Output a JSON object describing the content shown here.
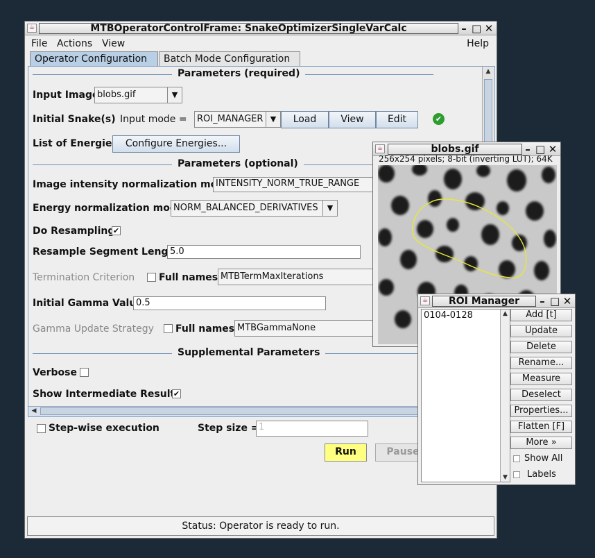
{
  "main_window": {
    "title": "MTBOperatorControlFrame: SnakeOptimizerSingleVarCalc",
    "menu": [
      "File",
      "Actions",
      "View"
    ],
    "help": "Help",
    "tabs": [
      "Operator Configuration",
      "Batch Mode Configuration"
    ],
    "sections": {
      "required": "Parameters (required)",
      "optional": "Parameters (optional)",
      "supplemental": "Supplemental Parameters"
    },
    "input_image": {
      "label": "Input Image",
      "value": "blobs.gif"
    },
    "initial_snakes": {
      "label": "Initial Snake(s)",
      "mode_label": "Input mode =",
      "mode_value": "ROI_MANAGER",
      "load": "Load",
      "view": "View",
      "edit": "Edit"
    },
    "energies": {
      "label": "List of Energies",
      "button": "Configure Energies..."
    },
    "intensity_norm": {
      "label": "Image intensity normalization mode",
      "value": "INTENSITY_NORM_TRUE_RANGE"
    },
    "energy_norm": {
      "label": "Energy normalization mode",
      "value": "NORM_BALANCED_DERIVATIVES"
    },
    "resampling": {
      "label": "Do Resampling",
      "checked": "✔"
    },
    "segment_length": {
      "label": "Resample Segment Length",
      "value": "5.0"
    },
    "termination": {
      "label": "Termination Criterion",
      "full_names": "Full names",
      "value": "MTBTermMaxIterations"
    },
    "gamma_value": {
      "label": "Initial Gamma Value",
      "value": "0.5"
    },
    "gamma_strategy": {
      "label": "Gamma Update Strategy",
      "full_names": "Full names",
      "value": "MTBGammaNone"
    },
    "verbose": {
      "label": "Verbose"
    },
    "intermediate": {
      "label": "Show Intermediate Results",
      "checked": "✔"
    },
    "stepwise": {
      "label": "Step-wise execution"
    },
    "step_size": {
      "label": "Step size =",
      "value": "1"
    },
    "run": "Run",
    "pause": "Pause",
    "status": "Status: Operator is ready to run.",
    "colors": {
      "tab_selected": "#b8cfe5",
      "run_button": "#ffff80",
      "border_blue": "#7c9cc0",
      "ok_green": "#2e9c2e"
    }
  },
  "image_window": {
    "title": "blobs.gif",
    "info": "256x254 pixels; 8-bit (inverting LUT); 64K",
    "roi_color": "#e8e83a"
  },
  "roi_manager": {
    "title": "ROI Manager",
    "items": [
      "0104-0128"
    ],
    "buttons": [
      "Add [t]",
      "Update",
      "Delete",
      "Rename...",
      "Measure",
      "Deselect",
      "Properties...",
      "Flatten [F]",
      "More »"
    ],
    "show_all": "Show All",
    "labels": "Labels"
  }
}
